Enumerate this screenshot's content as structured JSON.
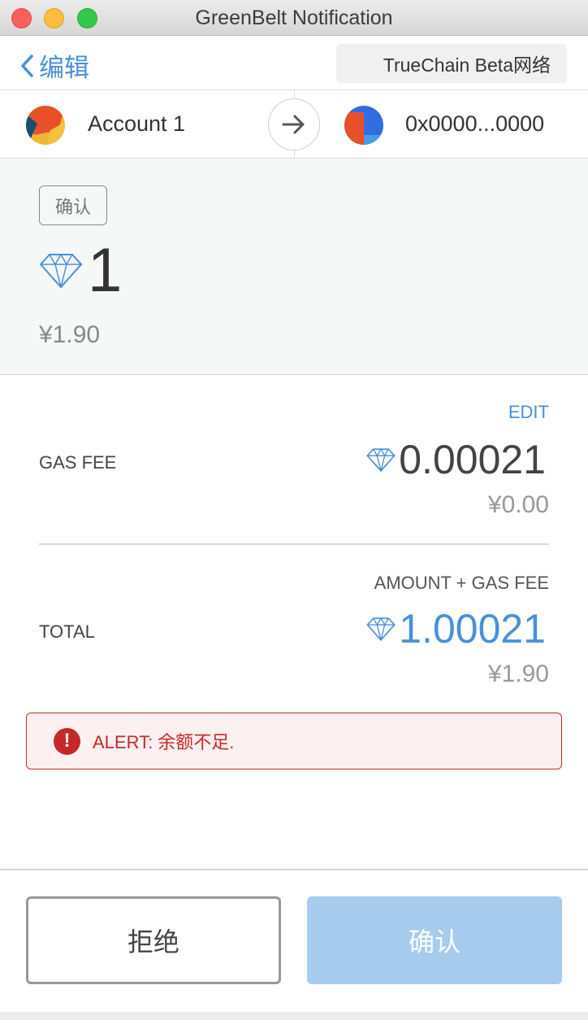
{
  "window": {
    "title": "GreenBelt Notification"
  },
  "header": {
    "back_label": "编辑",
    "network_label": "TrueChain Beta网络"
  },
  "accounts": {
    "from_name": "Account 1",
    "to_address": "0x0000...0000"
  },
  "summary": {
    "badge": "确认",
    "amount": "1",
    "fiat": "¥1.90"
  },
  "details": {
    "edit_label": "EDIT",
    "gas_fee_label": "GAS FEE",
    "gas_fee_value": "0.00021",
    "gas_fee_fiat": "¥0.00",
    "amount_gas_label": "AMOUNT + GAS FEE",
    "total_label": "TOTAL",
    "total_value": "1.00021",
    "total_fiat": "¥1.90"
  },
  "alert": {
    "icon": "!",
    "text": "ALERT: 余额不足."
  },
  "footer": {
    "reject_label": "拒绝",
    "confirm_label": "确认"
  },
  "colors": {
    "accent": "#4a90d9",
    "alert": "#c62828",
    "confirm_disabled": "#a6cbed"
  }
}
